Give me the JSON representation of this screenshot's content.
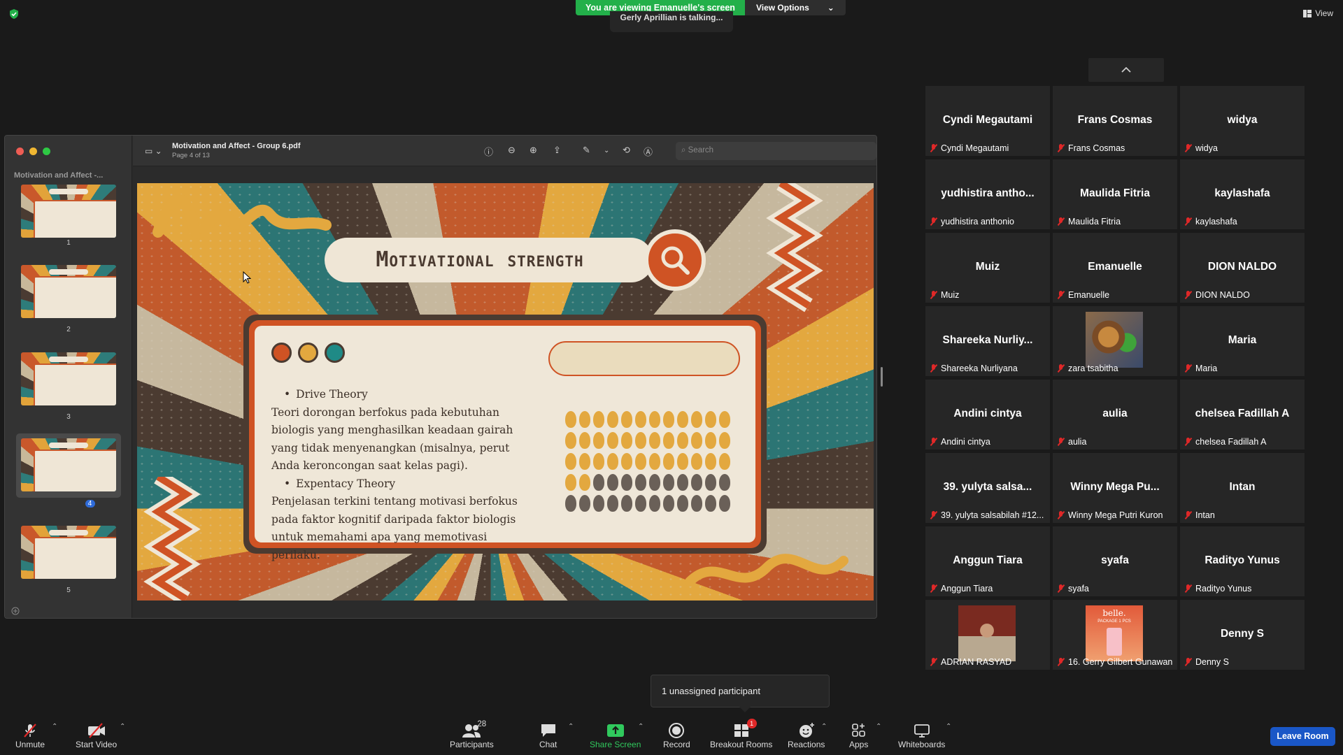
{
  "banner": {
    "viewing": "You are viewing Emanuelle's screen",
    "view_options": "View Options"
  },
  "talking": "Gerly Aprillian is talking...",
  "view_button": "View",
  "window": {
    "sidebar_title": "Motivation and Affect -...",
    "doc_title": "Motivation and Affect - Group 6.pdf",
    "page_label": "Page 4 of 13",
    "search_placeholder": "Search",
    "thumbs": [
      "1",
      "2",
      "3",
      "4",
      "5"
    ]
  },
  "slide": {
    "title": "Motivational strength",
    "bullet1": "Drive Theory",
    "para1": "Teori dorongan berfokus pada kebutuhan biologis yang menghasilkan keadaan gairah yang tidak menyenangkan (misalnya, perut Anda keroncongan saat kelas pagi).",
    "bullet2": "Expentacy Theory",
    "para2": "Penjelasan terkini tentang motivasi berfokus pada faktor kognitif daripada faktor biologis untuk memahami apa yang memotivasi perilaku.",
    "colors": {
      "orange": "#cf5324",
      "yellow": "#e3a83f",
      "teal": "#1f8a86",
      "brown": "#4b3b31"
    }
  },
  "participants": [
    {
      "name": "Cyndi Megautami",
      "label": "Cyndi Megautami"
    },
    {
      "name": "Frans Cosmas",
      "label": "Frans Cosmas"
    },
    {
      "name": "widya",
      "label": "widya"
    },
    {
      "name": "yudhistira antho...",
      "label": "yudhistira anthonio"
    },
    {
      "name": "Maulida Fitria",
      "label": "Maulida Fitria"
    },
    {
      "name": "kaylashafa",
      "label": "kaylashafa"
    },
    {
      "name": "Muiz",
      "label": "Muiz"
    },
    {
      "name": "Emanuelle",
      "label": "Emanuelle"
    },
    {
      "name": "DION NALDO",
      "label": "DION NALDO"
    },
    {
      "name": "Shareeka Nurliy...",
      "label": "Shareeka Nurliyana"
    },
    {
      "name": "",
      "label": "zara tsabitha"
    },
    {
      "name": "Maria",
      "label": "Maria"
    },
    {
      "name": "Andini cintya",
      "label": "Andini cintya"
    },
    {
      "name": "aulia",
      "label": "aulia"
    },
    {
      "name": "chelsea Fadillah A",
      "label": "chelsea Fadillah A"
    },
    {
      "name": "39. yulyta salsa...",
      "label": "39. yulyta salsabilah #12..."
    },
    {
      "name": "Winny Mega Pu...",
      "label": "Winny Mega Putri Kuron"
    },
    {
      "name": "Intan",
      "label": "Intan"
    },
    {
      "name": "Anggun Tiara",
      "label": "Anggun Tiara"
    },
    {
      "name": "syafa",
      "label": "syafa"
    },
    {
      "name": "Radityo Yunus",
      "label": "Radityo Yunus"
    },
    {
      "name": "",
      "label": "ADRIAN RASYAD"
    },
    {
      "name": "",
      "label": "16. Gerry Gilbert Gunawan ..."
    },
    {
      "name": "Denny S",
      "label": "Denny S"
    }
  ],
  "photo_text": "belle.",
  "photo_subtext": "PACKAGE 1 PCS",
  "toast": "1 unassigned participant",
  "toolbar": {
    "unmute": "Unmute",
    "start_video": "Start Video",
    "participants": "Participants",
    "participants_count": "28",
    "chat": "Chat",
    "share_screen": "Share Screen",
    "record": "Record",
    "breakout": "Breakout Rooms",
    "breakout_badge": "1",
    "reactions": "Reactions",
    "apps": "Apps",
    "whiteboards": "Whiteboards",
    "leave": "Leave Room"
  }
}
